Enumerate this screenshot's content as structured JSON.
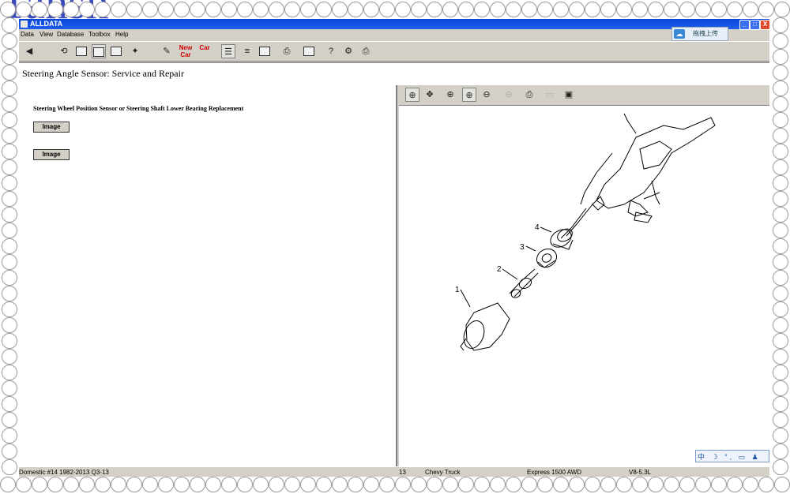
{
  "watermark": "Tansh",
  "window": {
    "title": "ALLDATA",
    "minimize": "_",
    "maximize": "□",
    "close": "X"
  },
  "menu": {
    "items": [
      "Data",
      "View",
      "Database",
      "Toolbox",
      "Help"
    ]
  },
  "ime_bar": {
    "label": "拖拽上传"
  },
  "toolbar": {
    "new_car_label": "New Car",
    "car_label": "Car"
  },
  "header": {
    "title": "Steering Angle Sensor:  Service and Repair"
  },
  "content": {
    "procedure_title": "Steering Wheel Position Sensor or Steering Shaft Lower Bearing Replacement",
    "image_button_1": "Image",
    "image_button_2": "Image"
  },
  "diagram": {
    "callouts": [
      "1",
      "2",
      "3",
      "4"
    ]
  },
  "ime_bar2": {
    "label": "中 ☽ °, ▭ ♟ ✱"
  },
  "status": {
    "domestic": "Domestic #14 1982-2013 Q3-13",
    "num": "13",
    "make": "Chevy Truck",
    "model": "Express 1500 AWD",
    "engine": "V8-5.3L"
  }
}
